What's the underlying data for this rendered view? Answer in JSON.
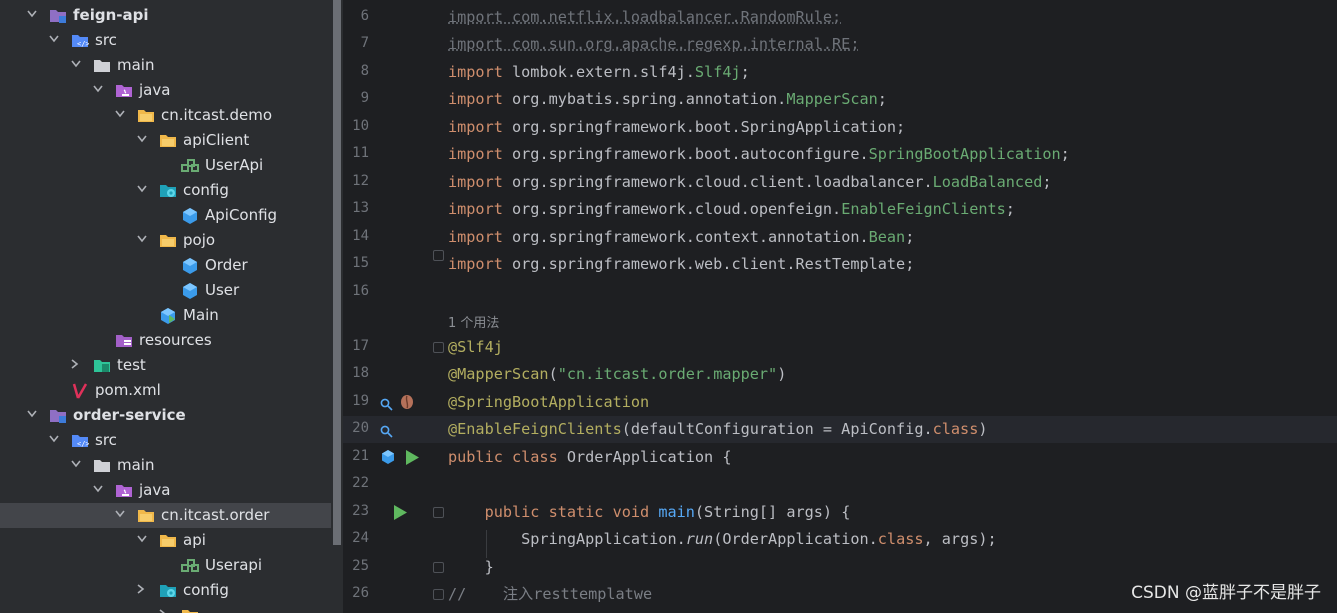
{
  "tree": {
    "rows": [
      {
        "label": "feign-api",
        "icon": "module-folder-icon",
        "name": "tree-item-feign-api",
        "bold": true,
        "arrow": "down"
      },
      {
        "label": "src",
        "icon": "source-folder-icon",
        "name": "tree-item-src",
        "arrow": "down"
      },
      {
        "label": "main",
        "icon": "folder-icon",
        "name": "tree-item-main",
        "arrow": "down"
      },
      {
        "label": "java",
        "icon": "java-source-root-icon",
        "name": "tree-item-java",
        "arrow": "down"
      },
      {
        "label": "cn.itcast.demo",
        "icon": "package-icon",
        "name": "tree-item-cn-itcast-demo",
        "arrow": "down"
      },
      {
        "label": "apiClient",
        "icon": "package-icon",
        "name": "tree-item-apiclient",
        "arrow": "down"
      },
      {
        "label": "UserApi",
        "icon": "interface-icon",
        "name": "tree-item-userapi"
      },
      {
        "label": "config",
        "icon": "config-package-icon",
        "name": "tree-item-config",
        "arrow": "down"
      },
      {
        "label": "ApiConfig",
        "icon": "class-icon",
        "name": "tree-item-apiconfig"
      },
      {
        "label": "pojo",
        "icon": "package-icon",
        "name": "tree-item-pojo",
        "arrow": "down"
      },
      {
        "label": "Order",
        "icon": "class-icon",
        "name": "tree-item-order"
      },
      {
        "label": "User",
        "icon": "class-icon",
        "name": "tree-item-user"
      },
      {
        "label": "Main",
        "icon": "main-class-icon",
        "name": "tree-item-main-class"
      },
      {
        "label": "resources",
        "icon": "resources-folder-icon",
        "name": "tree-item-resources"
      },
      {
        "label": "test",
        "icon": "test-folder-icon",
        "name": "tree-item-test",
        "arrow": "right"
      },
      {
        "label": "pom.xml",
        "icon": "maven-icon",
        "name": "tree-item-pom-xml"
      },
      {
        "label": "order-service",
        "icon": "module-folder-icon",
        "name": "tree-item-order-service",
        "bold": true,
        "arrow": "down"
      },
      {
        "label": "src",
        "icon": "source-folder-icon",
        "name": "tree-item-src-2",
        "arrow": "down"
      },
      {
        "label": "main",
        "icon": "folder-icon",
        "name": "tree-item-main-2",
        "arrow": "down"
      },
      {
        "label": "java",
        "icon": "java-source-root-icon",
        "name": "tree-item-java-2",
        "arrow": "down"
      },
      {
        "label": "cn.itcast.order",
        "icon": "package-icon",
        "name": "tree-item-cn-itcast-order",
        "arrow": "down",
        "selected": true
      },
      {
        "label": "api",
        "icon": "package-icon",
        "name": "tree-item-api",
        "arrow": "down"
      },
      {
        "label": "Userapi",
        "icon": "interface-icon",
        "name": "tree-item-userapi-2"
      },
      {
        "label": "config",
        "icon": "config-package-icon",
        "name": "tree-item-config-2",
        "arrow": "right"
      },
      {
        "label": "",
        "icon": "package-icon",
        "name": "tree-item-partial",
        "arrow": "right"
      }
    ]
  },
  "editor": {
    "inlay_hint": "1 个用法",
    "lines": [
      {
        "n": "6",
        "html": "<span class=\"dim\">import com.netflix.loadbalancer.RandomRule;</span>"
      },
      {
        "n": "7",
        "html": "<span class=\"dim\">import com.sun.org.apache.regexp.internal.RE;</span>"
      },
      {
        "n": "8",
        "html": "<span class=\"kw\">import</span> lombok.extern.slf4j.<span class=\"grn\">Slf4j</span>;"
      },
      {
        "n": "9",
        "html": "<span class=\"kw\">import</span> org.mybatis.spring.annotation.<span class=\"grn\">MapperScan</span>;"
      },
      {
        "n": "10",
        "html": "<span class=\"kw\">import</span> org.springframework.boot.SpringApplication;"
      },
      {
        "n": "11",
        "html": "<span class=\"kw\">import</span> org.springframework.boot.autoconfigure.<span class=\"grn\">SpringBootApplication</span>;"
      },
      {
        "n": "12",
        "html": "<span class=\"kw\">import</span> org.springframework.cloud.client.loadbalancer.<span class=\"grn\">LoadBalanced</span>;"
      },
      {
        "n": "13",
        "html": "<span class=\"kw\">import</span> org.springframework.cloud.openfeign.<span class=\"grn\">EnableFeignClients</span>;"
      },
      {
        "n": "14",
        "html": "<span class=\"kw\">import</span> org.springframework.context.annotation.<span class=\"grn\">Bean</span>;"
      },
      {
        "n": "15",
        "html": "<span class=\"kw\">import</span> org.springframework.web.client.RestTemplate;"
      },
      {
        "n": "16",
        "html": ""
      },
      {
        "n": "",
        "hint": true
      },
      {
        "n": "17",
        "html": "<span class=\"ann\">@Slf4j</span>"
      },
      {
        "n": "18",
        "html": "<span class=\"ann\">@MapperScan</span>(<span class=\"str\">\"cn.itcast.order.mapper\"</span>)"
      },
      {
        "n": "19",
        "html": "<span class=\"ann\">@SpringBootApplication</span>"
      },
      {
        "n": "20",
        "html": "<span class=\"ann\">@EnableFeignClients</span>(defaultConfiguration = ApiConfig.<span class=\"kw\">class</span>)",
        "current": true
      },
      {
        "n": "21",
        "html": "<span class=\"kw\">public class</span> OrderApplication {"
      },
      {
        "n": "22",
        "html": ""
      },
      {
        "n": "23",
        "html": "    <span class=\"kw\">public static void</span> <span style=\"color:#56a8f5\">main</span>(String[] args) {"
      },
      {
        "n": "24",
        "html": "        SpringApplication.<span class=\"ital\">run</span>(OrderApplication.<span class=\"kw\">class</span>, args);"
      },
      {
        "n": "25",
        "html": "    }"
      },
      {
        "n": "26",
        "html": "<span class=\"cmt\">//    注入resttemplatwe</span>"
      }
    ]
  },
  "watermark": "CSDN @蓝胖子不是胖子"
}
